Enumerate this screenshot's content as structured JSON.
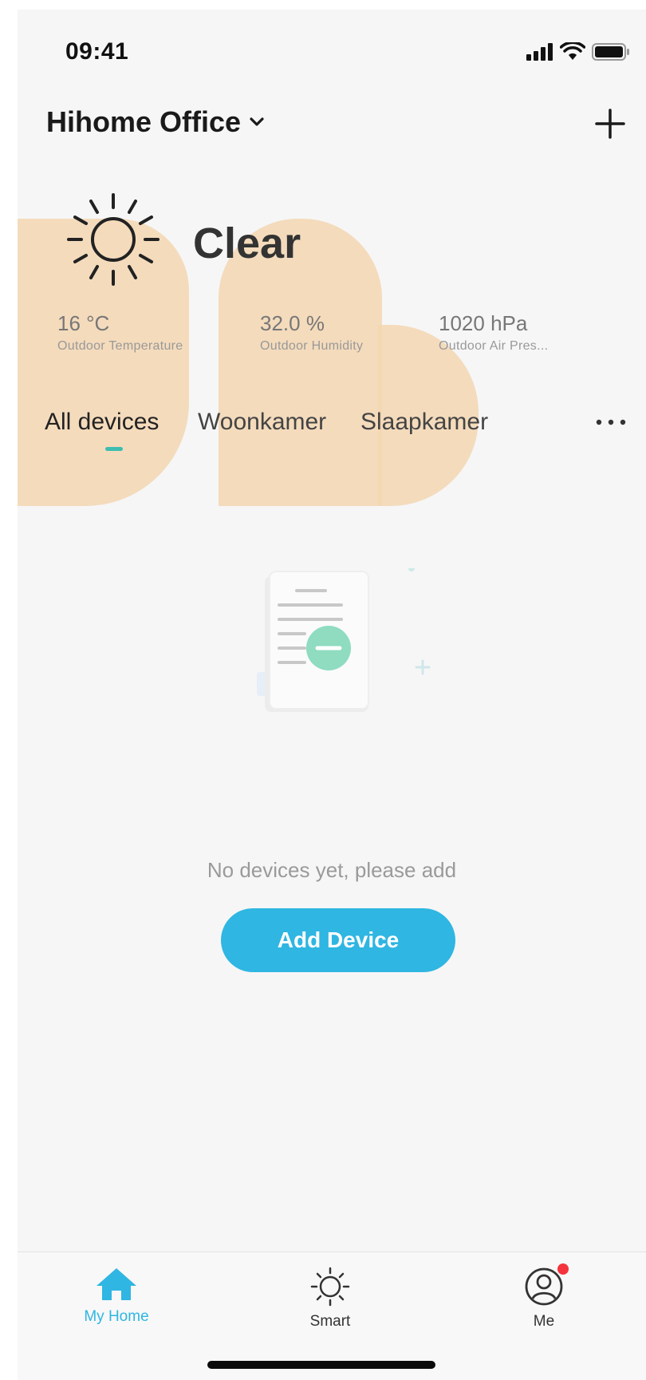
{
  "status_bar": {
    "time": "09:41"
  },
  "header": {
    "home_name": "Hihome Office"
  },
  "weather": {
    "condition": "Clear",
    "stats": [
      {
        "value": "16 °C",
        "label": "Outdoor Temperature"
      },
      {
        "value": "32.0 %",
        "label": "Outdoor Humidity"
      },
      {
        "value": "1020 hPa",
        "label": "Outdoor Air Pres..."
      }
    ]
  },
  "tabs": [
    {
      "label": "All devices",
      "active": true
    },
    {
      "label": "Woonkamer",
      "active": false
    },
    {
      "label": "Slaapkamer",
      "active": false
    }
  ],
  "empty_state": {
    "message": "No devices yet, please add",
    "button_label": "Add Device"
  },
  "bottom_nav": [
    {
      "label": "My Home",
      "icon": "home-icon",
      "active": true
    },
    {
      "label": "Smart",
      "icon": "sun-icon",
      "active": false
    },
    {
      "label": "Me",
      "icon": "user-icon",
      "active": false,
      "badge": true
    }
  ],
  "colors": {
    "accent": "#2fb6e2",
    "tab_indicator": "#3cbdb0",
    "badge": "#f4333c",
    "blob": "#f3d6b2"
  }
}
